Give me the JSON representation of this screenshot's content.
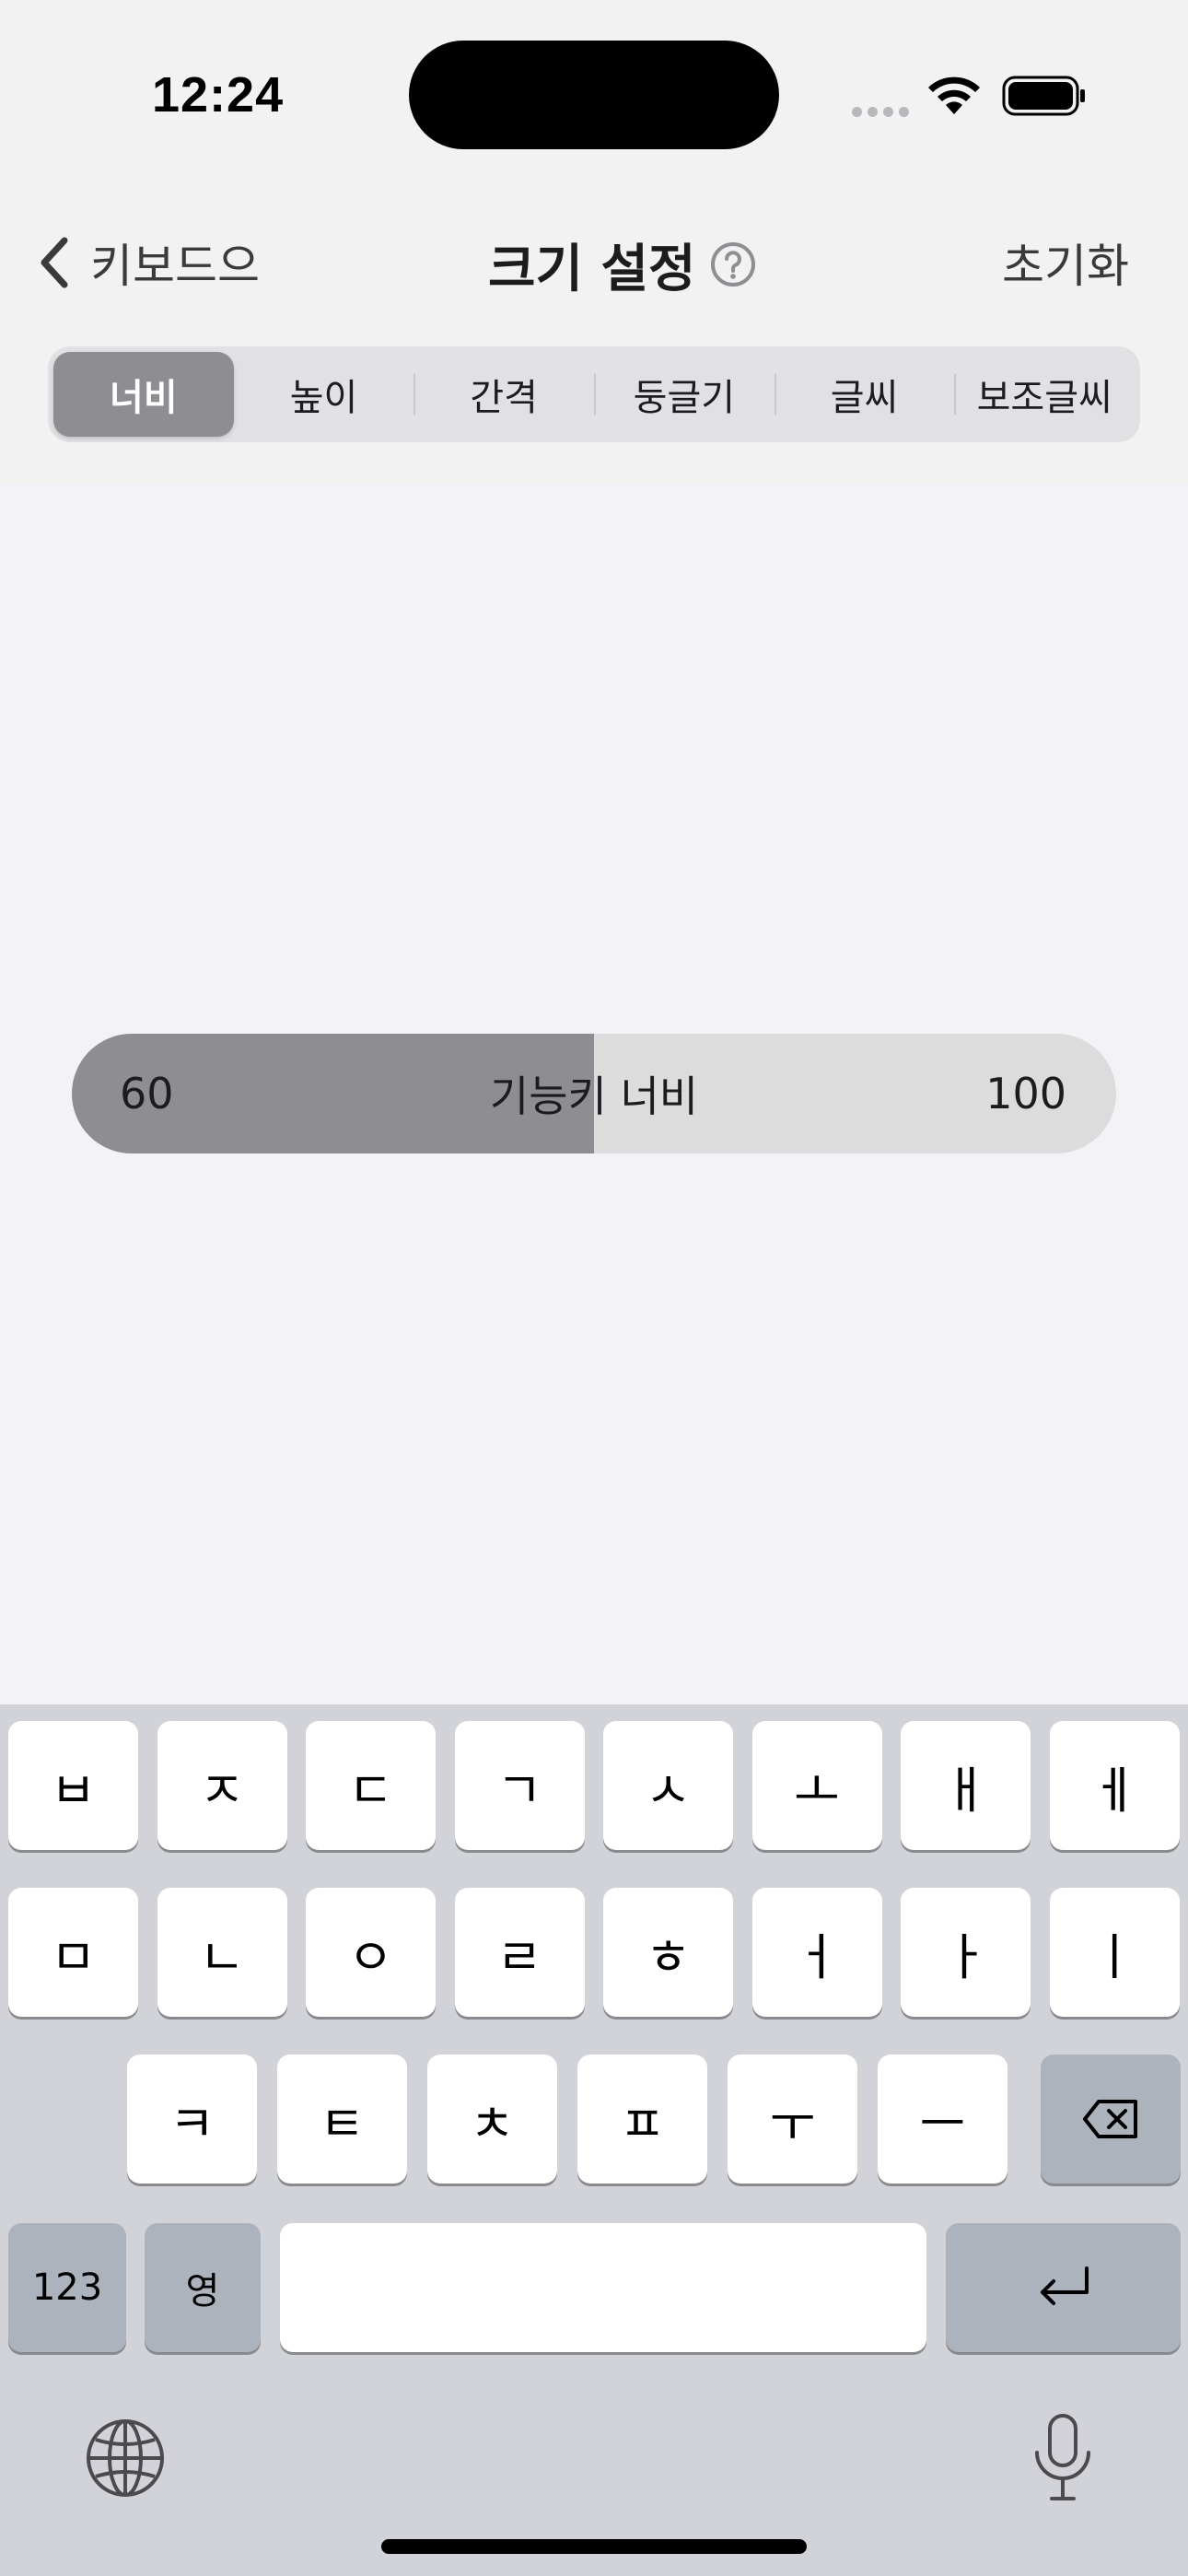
{
  "status_bar": {
    "time": "12:24"
  },
  "nav": {
    "back_label": "키보드으",
    "title": "크기 설정",
    "reset_label": "초기화"
  },
  "tabs": [
    {
      "label": "너비",
      "selected": true
    },
    {
      "label": "높이",
      "selected": false
    },
    {
      "label": "간격",
      "selected": false
    },
    {
      "label": "둥글기",
      "selected": false
    },
    {
      "label": "글씨",
      "selected": false
    },
    {
      "label": "보조글씨",
      "selected": false
    }
  ],
  "slider": {
    "min_label": "60",
    "max_label": "100",
    "label": "기능키 너비",
    "fill_fraction": 0.5
  },
  "keyboard": {
    "row1": [
      "ㅂ",
      "ㅈ",
      "ㄷ",
      "ㄱ",
      "ㅅ",
      "ㅗ",
      "ㅐ",
      "ㅔ"
    ],
    "row2": [
      "ㅁ",
      "ㄴ",
      "ㅇ",
      "ㄹ",
      "ㅎ",
      "ㅓ",
      "ㅏ",
      "ㅣ"
    ],
    "row3": [
      "ㅋ",
      "ㅌ",
      "ㅊ",
      "ㅍ",
      "ㅜ",
      "ㅡ"
    ],
    "numbers_key": "123",
    "lang_key": "영",
    "backspace_icon": "delete-left-icon",
    "return_icon": "return-icon",
    "globe_icon": "globe-icon",
    "mic_icon": "microphone-icon"
  },
  "colors": {
    "selected_segment": "#8e8d92",
    "slider_fill": "#8e8d92",
    "slider_track": "#dcdcdc",
    "keyboard_bg": "#d1d3d9",
    "special_key": "#adb3bc"
  }
}
